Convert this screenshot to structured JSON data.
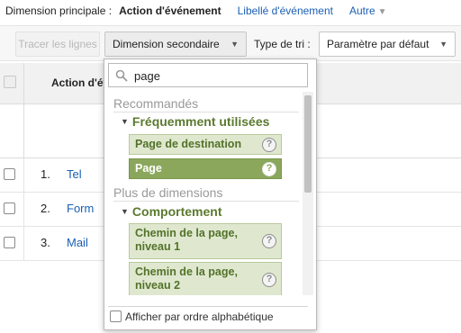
{
  "dimension_bar": {
    "label": "Dimension principale :",
    "active": "Action d'événement",
    "link": "Libellé d'événement",
    "other": "Autre"
  },
  "toolbar": {
    "plot_rows": "Tracer les lignes",
    "secondary_dimension": "Dimension secondaire",
    "sort_label": "Type de tri :",
    "sort_value": "Paramètre par défaut"
  },
  "table": {
    "column_header": "Action d'év",
    "rows": [
      {
        "num": "1.",
        "value": "Tel"
      },
      {
        "num": "2.",
        "value": "Form"
      },
      {
        "num": "3.",
        "value": "Mail"
      }
    ]
  },
  "dropdown": {
    "search_value": "page",
    "groups": [
      {
        "title": "Recommandés",
        "subgroup": "Fréquemment utilisées",
        "items": [
          "Page de destination",
          "Page"
        ]
      },
      {
        "title": "Plus de dimensions",
        "subgroup": "Comportement",
        "items": [
          "Chemin de la page, niveau 1",
          "Chemin de la page, niveau 2"
        ]
      }
    ],
    "selected_item": "Page",
    "help_glyph": "?",
    "footer_label": "Afficher par ordre alphabétique"
  },
  "colors": {
    "link": "#1a5fb4",
    "item_bg": "#dfe8cf",
    "item_text": "#53722a",
    "selected_bg": "#8aa75b"
  },
  "icons": {
    "search": "search-icon",
    "help": "help-icon",
    "caret": "chevron-down-icon",
    "expand": "triangle-down-icon"
  }
}
